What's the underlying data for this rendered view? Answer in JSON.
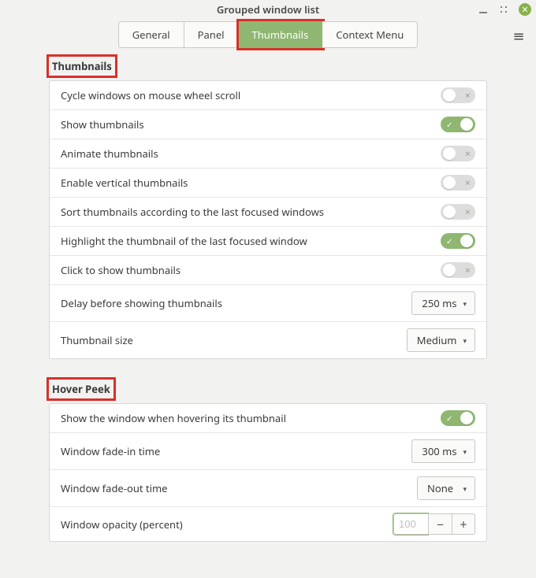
{
  "window": {
    "title": "Grouped window list"
  },
  "tabs": [
    {
      "id": "general",
      "label": "General",
      "active": false
    },
    {
      "id": "panel",
      "label": "Panel",
      "active": false
    },
    {
      "id": "thumbs",
      "label": "Thumbnails",
      "active": true
    },
    {
      "id": "ctx",
      "label": "Context Menu",
      "active": false
    }
  ],
  "sections": {
    "thumbnails": {
      "title": "Thumbnails",
      "rows": {
        "cycle_scroll": {
          "label": "Cycle windows on mouse wheel scroll",
          "toggle": false
        },
        "show_thumbs": {
          "label": "Show thumbnails",
          "toggle": true
        },
        "animate": {
          "label": "Animate thumbnails",
          "toggle": false
        },
        "vertical": {
          "label": "Enable vertical thumbnails",
          "toggle": false
        },
        "sort_last": {
          "label": "Sort thumbnails according to the last focused windows",
          "toggle": false
        },
        "highlight_last": {
          "label": "Highlight the thumbnail of the last focused window",
          "toggle": true
        },
        "click_show": {
          "label": "Click to show thumbnails",
          "toggle": false
        },
        "delay": {
          "label": "Delay before showing thumbnails",
          "value": "250 ms"
        },
        "size": {
          "label": "Thumbnail size",
          "value": "Medium"
        }
      }
    },
    "hover": {
      "title": "Hover Peek",
      "rows": {
        "show_hover": {
          "label": "Show the window when hovering its thumbnail",
          "toggle": true
        },
        "fade_in": {
          "label": "Window fade-in time",
          "value": "300 ms"
        },
        "fade_out": {
          "label": "Window fade-out time",
          "value": "None"
        },
        "opacity": {
          "label": "Window opacity (percent)",
          "value": "100"
        }
      }
    }
  },
  "icons": {
    "check": "✓",
    "cross": "✕",
    "caret": "▾",
    "hamburger": "≡",
    "minus": "−",
    "plus": "+"
  }
}
